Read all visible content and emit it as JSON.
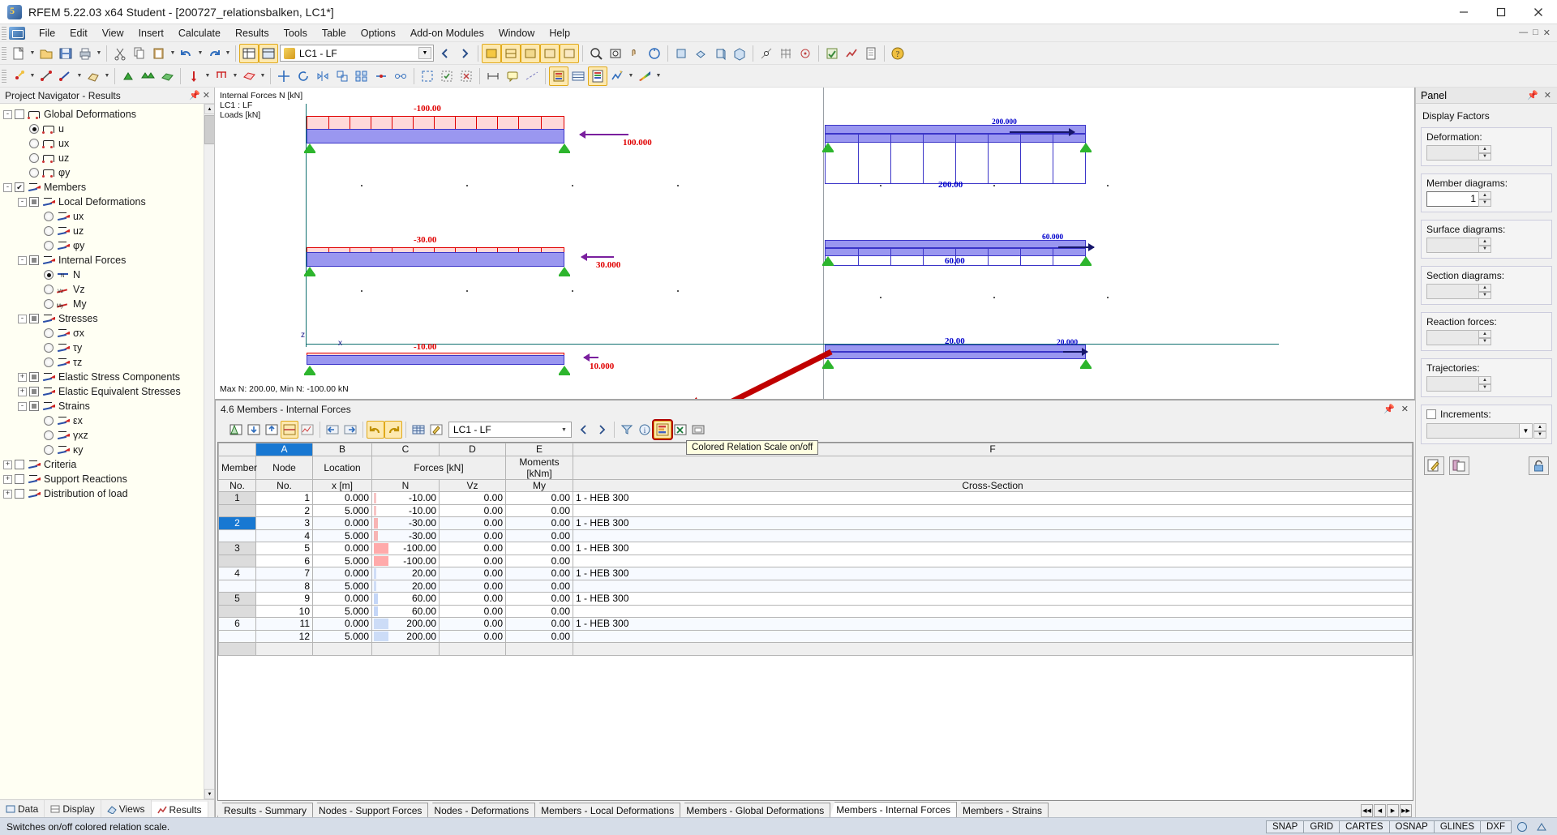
{
  "window": {
    "title": "RFEM 5.22.03 x64 Student - [200727_relationsbalken, LC1*]",
    "app_icon": "rfem-icon",
    "minimize": "minimize-icon",
    "maximize": "maximize-icon",
    "close": "close-icon",
    "inner_minimize": "inner-minimize-icon",
    "inner_restore": "inner-restore-icon",
    "inner_close": "inner-close-icon"
  },
  "menu": {
    "items": [
      "File",
      "Edit",
      "View",
      "Insert",
      "Calculate",
      "Results",
      "Tools",
      "Table",
      "Options",
      "Add-on Modules",
      "Window",
      "Help"
    ]
  },
  "toolbar": {
    "load_case": "LC1 - LF"
  },
  "navigator": {
    "title": "Project Navigator - Results",
    "pin": "pin-icon",
    "close": "close-icon",
    "tree": [
      {
        "label": "Global Deformations",
        "level": 1,
        "expander": "-",
        "control": "checkbox-empty",
        "icon": "deformation-icon"
      },
      {
        "label": "u",
        "level": 2,
        "expander": "",
        "control": "radio-on",
        "icon": "deformation-icon"
      },
      {
        "label": "ux",
        "level": 2,
        "expander": "",
        "control": "radio-off",
        "icon": "deformation-icon"
      },
      {
        "label": "uz",
        "level": 2,
        "expander": "",
        "control": "radio-off",
        "icon": "deformation-icon"
      },
      {
        "label": "φy",
        "level": 2,
        "expander": "",
        "control": "radio-off",
        "icon": "deformation-icon"
      },
      {
        "label": "Members",
        "level": 1,
        "expander": "-",
        "control": "checkbox-checked",
        "icon": "member-icon"
      },
      {
        "label": "Local Deformations",
        "level": 2,
        "expander": "-",
        "control": "checkbox-partial",
        "icon": "member-icon"
      },
      {
        "label": "ux",
        "level": 3,
        "expander": "",
        "control": "radio-off",
        "icon": "member-icon"
      },
      {
        "label": "uz",
        "level": 3,
        "expander": "",
        "control": "radio-off",
        "icon": "member-icon"
      },
      {
        "label": "φy",
        "level": 3,
        "expander": "",
        "control": "radio-off",
        "icon": "member-icon"
      },
      {
        "label": "Internal Forces",
        "level": 2,
        "expander": "-",
        "control": "checkbox-partial",
        "icon": "member-icon"
      },
      {
        "label": "N",
        "level": 3,
        "expander": "",
        "control": "radio-on",
        "icon": "axial-force-icon"
      },
      {
        "label": "Vz",
        "level": 3,
        "expander": "",
        "control": "radio-off",
        "icon": "shear-force-icon"
      },
      {
        "label": "My",
        "level": 3,
        "expander": "",
        "control": "radio-off",
        "icon": "moment-icon"
      },
      {
        "label": "Stresses",
        "level": 2,
        "expander": "-",
        "control": "checkbox-partial",
        "icon": "member-icon"
      },
      {
        "label": "σx",
        "level": 3,
        "expander": "",
        "control": "radio-off",
        "icon": "member-icon"
      },
      {
        "label": "τy",
        "level": 3,
        "expander": "",
        "control": "radio-off",
        "icon": "member-icon"
      },
      {
        "label": "τz",
        "level": 3,
        "expander": "",
        "control": "radio-off",
        "icon": "member-icon"
      },
      {
        "label": "Elastic Stress Components",
        "level": 2,
        "expander": "+",
        "control": "checkbox-partial",
        "icon": "member-icon"
      },
      {
        "label": "Elastic Equivalent Stresses",
        "level": 2,
        "expander": "+",
        "control": "checkbox-partial",
        "icon": "member-icon"
      },
      {
        "label": "Strains",
        "level": 2,
        "expander": "-",
        "control": "checkbox-partial",
        "icon": "member-icon"
      },
      {
        "label": "εx",
        "level": 3,
        "expander": "",
        "control": "radio-off",
        "icon": "member-icon"
      },
      {
        "label": "γxz",
        "level": 3,
        "expander": "",
        "control": "radio-off",
        "icon": "member-icon"
      },
      {
        "label": "κy",
        "level": 3,
        "expander": "",
        "control": "radio-off",
        "icon": "member-icon"
      },
      {
        "label": "Criteria",
        "level": 1,
        "expander": "+",
        "control": "checkbox-empty",
        "icon": "member-icon"
      },
      {
        "label": "Support Reactions",
        "level": 1,
        "expander": "+",
        "control": "checkbox-empty",
        "icon": "support-icon"
      },
      {
        "label": "Distribution of load",
        "level": 1,
        "expander": "+",
        "control": "checkbox-empty",
        "icon": "load-icon"
      }
    ],
    "tabs": [
      {
        "label": "Data",
        "icon": "data-icon",
        "selected": false
      },
      {
        "label": "Display",
        "icon": "display-icon",
        "selected": false
      },
      {
        "label": "Views",
        "icon": "views-icon",
        "selected": false
      },
      {
        "label": "Results",
        "icon": "results-icon",
        "selected": true
      }
    ]
  },
  "graphics": {
    "info_line1": "Internal Forces N [kN]",
    "info_line2": "LC1 : LF",
    "info_line3": "Loads [kN]",
    "max_min": "Max N: 200.00, Min N: -100.00 kN",
    "axis_z": "z",
    "axis_x": "x",
    "left_beams": [
      {
        "diagram_label": "-100.00",
        "load_label": "100.000"
      },
      {
        "diagram_label": "-30.00",
        "load_label": "30.000"
      },
      {
        "diagram_label": "-10.00",
        "load_label": "10.000"
      }
    ],
    "right_beams": [
      {
        "diagram_label": "200.000",
        "value_label": "200.00"
      },
      {
        "diagram_label": "60.000",
        "value_label": "60.00"
      },
      {
        "diagram_label": "20.000",
        "value_label": "20.00"
      }
    ]
  },
  "table_window": {
    "title": "4.6 Members - Internal Forces",
    "pin": "pin-icon",
    "close": "close-icon",
    "load_case": "LC1 - LF",
    "tooltip": "Colored Relation Scale on/off",
    "columns": [
      {
        "letter": "",
        "name": "member-no",
        "selected": false
      },
      {
        "letter": "A",
        "name": "node-no",
        "selected": true
      },
      {
        "letter": "B",
        "name": "location",
        "selected": false
      },
      {
        "letter": "C",
        "name": "force-n",
        "selected": false
      },
      {
        "letter": "D",
        "name": "force-vz",
        "selected": false
      },
      {
        "letter": "E",
        "name": "moment-my",
        "selected": false
      },
      {
        "letter": "F",
        "name": "cross-section",
        "selected": false
      }
    ],
    "header_row1": [
      "Member",
      "Node",
      "Location",
      "Forces [kN]",
      "",
      "Moments [kNm]",
      ""
    ],
    "header_row2": [
      "No.",
      "No.",
      "x [m]",
      "N",
      "Vz",
      "My",
      "Cross-Section"
    ],
    "rows": [
      {
        "member": "1",
        "node": "1",
        "location": "0.000",
        "n": "-10.00",
        "vz": "0.00",
        "my": "0.00",
        "section": "1 - HEB 300",
        "bar_color": "#f7c4c4",
        "bar_frac": 0.1,
        "bar_side": "neg",
        "member_sel": false
      },
      {
        "member": "",
        "node": "2",
        "location": "5.000",
        "n": "-10.00",
        "vz": "0.00",
        "my": "0.00",
        "section": "",
        "bar_color": "#f7c4c4",
        "bar_frac": 0.1,
        "bar_side": "neg",
        "member_sel": false
      },
      {
        "member": "2",
        "node": "3",
        "location": "0.000",
        "n": "-30.00",
        "vz": "0.00",
        "my": "0.00",
        "section": "1 - HEB 300",
        "bar_color": "#f7b4b4",
        "bar_frac": 0.3,
        "bar_side": "neg",
        "member_sel": true
      },
      {
        "member": "",
        "node": "4",
        "location": "5.000",
        "n": "-30.00",
        "vz": "0.00",
        "my": "0.00",
        "section": "",
        "bar_color": "#f7b4b4",
        "bar_frac": 0.3,
        "bar_side": "neg",
        "member_sel": false
      },
      {
        "member": "3",
        "node": "5",
        "location": "0.000",
        "n": "-100.00",
        "vz": "0.00",
        "my": "0.00",
        "section": "1 - HEB 300",
        "bar_color": "#ffaaaa",
        "bar_frac": 1.0,
        "bar_side": "neg",
        "member_sel": false
      },
      {
        "member": "",
        "node": "6",
        "location": "5.000",
        "n": "-100.00",
        "vz": "0.00",
        "my": "0.00",
        "section": "",
        "bar_color": "#ffaaaa",
        "bar_frac": 1.0,
        "bar_side": "neg",
        "member_sel": false
      },
      {
        "member": "4",
        "node": "7",
        "location": "0.000",
        "n": "20.00",
        "vz": "0.00",
        "my": "0.00",
        "section": "1 - HEB 300",
        "bar_color": "#cfddf7",
        "bar_frac": 0.1,
        "bar_side": "pos",
        "member_sel": false
      },
      {
        "member": "",
        "node": "8",
        "location": "5.000",
        "n": "20.00",
        "vz": "0.00",
        "my": "0.00",
        "section": "",
        "bar_color": "#cfddf7",
        "bar_frac": 0.1,
        "bar_side": "pos",
        "member_sel": false
      },
      {
        "member": "5",
        "node": "9",
        "location": "0.000",
        "n": "60.00",
        "vz": "0.00",
        "my": "0.00",
        "section": "1 - HEB 300",
        "bar_color": "#c4d6f7",
        "bar_frac": 0.3,
        "bar_side": "pos",
        "member_sel": false
      },
      {
        "member": "",
        "node": "10",
        "location": "5.000",
        "n": "60.00",
        "vz": "0.00",
        "my": "0.00",
        "section": "",
        "bar_color": "#c4d6f7",
        "bar_frac": 0.3,
        "bar_side": "pos",
        "member_sel": false
      },
      {
        "member": "6",
        "node": "11",
        "location": "0.000",
        "n": "200.00",
        "vz": "0.00",
        "my": "0.00",
        "section": "1 - HEB 300",
        "bar_color": "#ccdcf7",
        "bar_frac": 1.0,
        "bar_side": "pos",
        "member_sel": false
      },
      {
        "member": "",
        "node": "12",
        "location": "5.000",
        "n": "200.00",
        "vz": "0.00",
        "my": "0.00",
        "section": "",
        "bar_color": "#ccdcf7",
        "bar_frac": 1.0,
        "bar_side": "pos",
        "member_sel": false
      }
    ],
    "tabs": [
      {
        "label": "Results - Summary",
        "selected": false
      },
      {
        "label": "Nodes - Support Forces",
        "selected": false
      },
      {
        "label": "Nodes - Deformations",
        "selected": false
      },
      {
        "label": "Members - Local Deformations",
        "selected": false
      },
      {
        "label": "Members - Global Deformations",
        "selected": false
      },
      {
        "label": "Members - Internal Forces",
        "selected": true
      },
      {
        "label": "Members - Strains",
        "selected": false
      }
    ]
  },
  "panel": {
    "title": "Panel",
    "pin": "pin-icon",
    "close": "close-icon",
    "section_title": "Display Factors",
    "fields": [
      {
        "label": "Deformation:",
        "accel": "D",
        "value": "",
        "enabled": false
      },
      {
        "label": "Member diagrams:",
        "accel": "M",
        "value": "1",
        "enabled": true
      },
      {
        "label": "Surface diagrams:",
        "accel": "S",
        "value": "",
        "enabled": false
      },
      {
        "label": "Section diagrams:",
        "accel": "e",
        "value": "",
        "enabled": false
      },
      {
        "label": "Reaction forces:",
        "accel": "R",
        "value": "",
        "enabled": false
      },
      {
        "label": "Trajectories:",
        "accel": "T",
        "value": "",
        "enabled": false
      }
    ],
    "increments": {
      "label": "Increments:",
      "checked": false,
      "value": ""
    },
    "buttons": [
      {
        "name": "edit-panel-button",
        "icon": "pencil-note-icon"
      },
      {
        "name": "copy-panel-button",
        "icon": "copy-icon"
      },
      {
        "name": "lock-panel-button",
        "icon": "lock-icon"
      }
    ]
  },
  "statusbar": {
    "message": "Switches on/off colored relation scale.",
    "cells": [
      "SNAP",
      "GRID",
      "CARTES",
      "OSNAP",
      "GLINES",
      "DXF"
    ]
  },
  "colors": {
    "accent_blue": "#1878d2",
    "beam_fill": "#9a97f0",
    "beam_stroke": "#3b35c8",
    "load_red": "#e00000",
    "label_blue": "#0000cc",
    "highlight_red": "#b00000",
    "annotation_arrow": "#c00000"
  }
}
